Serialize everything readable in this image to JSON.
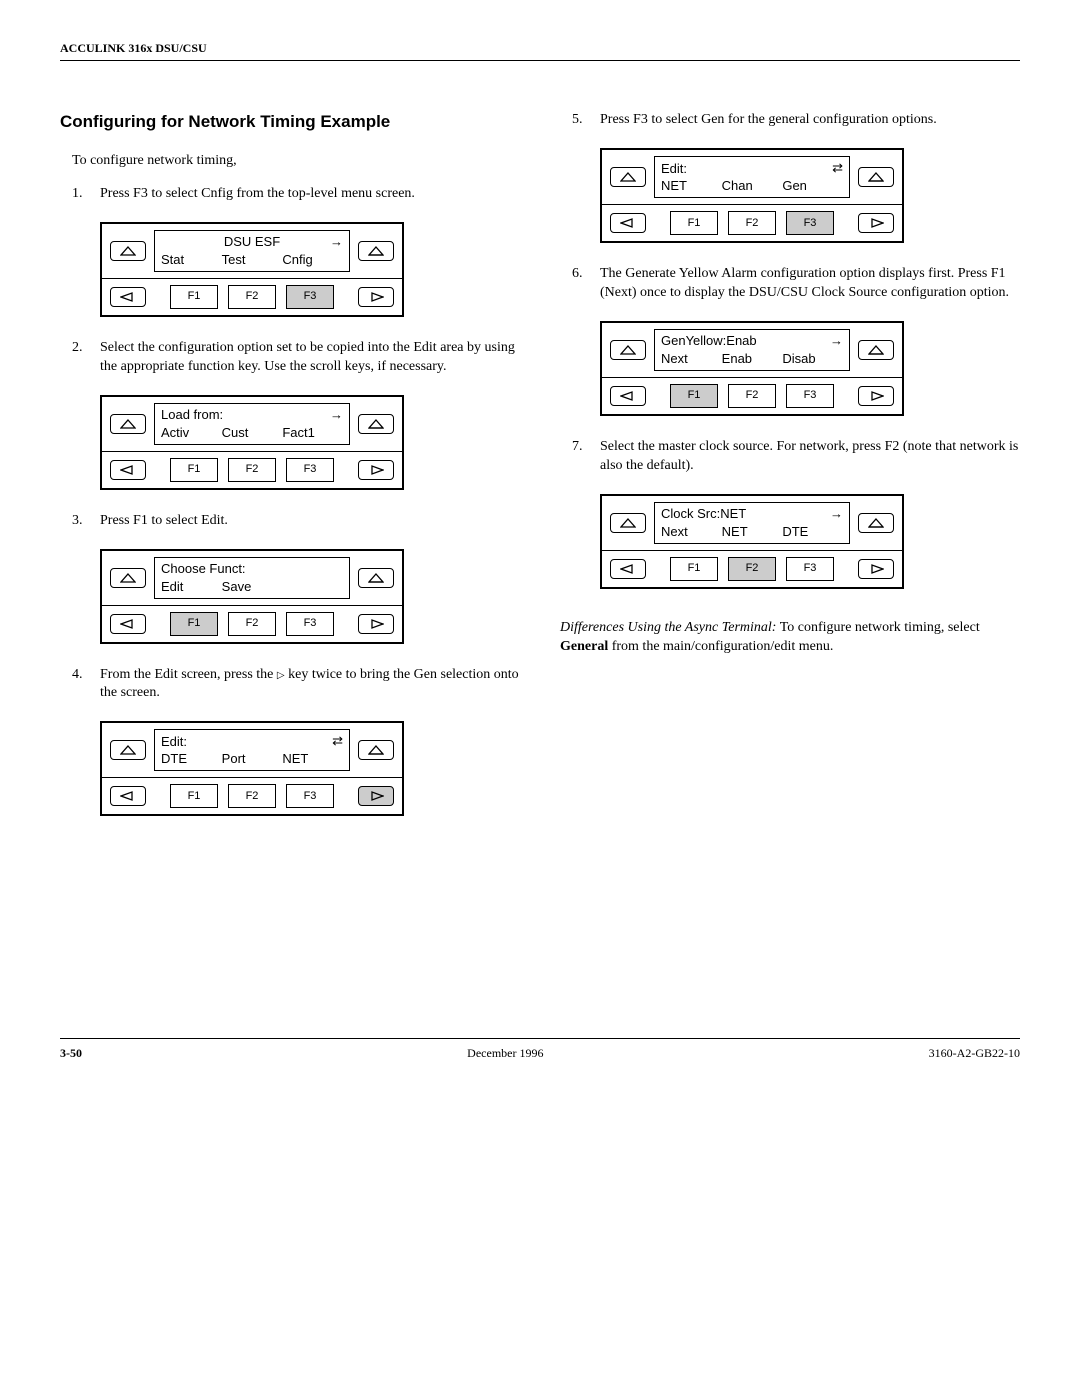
{
  "header": "ACCULINK 316x DSU/CSU",
  "section_title": "Configuring for Network Timing Example",
  "intro": "To configure network timing,",
  "left_steps": [
    {
      "num": "1.",
      "text": "Press F3 to select Cnfig from the top-level menu screen.",
      "lcd": {
        "l1": "DSU ESF",
        "l1_center": true,
        "l2": [
          "Stat",
          "Test",
          "Cnfig"
        ],
        "arrow": "→"
      },
      "keys": [
        {
          "t": "F1"
        },
        {
          "t": "F2"
        },
        {
          "t": "F3",
          "hi": true
        }
      ],
      "right_hi": false
    },
    {
      "num": "2.",
      "text": "Select the configuration option set to be copied into the Edit area by using the appropriate function key. Use the scroll keys, if necessary.",
      "lcd": {
        "l1": "Load from:",
        "l2": [
          "Activ",
          "Cust",
          "Fact1"
        ],
        "arrow": "→"
      },
      "keys": [
        {
          "t": "F1"
        },
        {
          "t": "F2"
        },
        {
          "t": "F3"
        }
      ],
      "right_hi": false
    },
    {
      "num": "3.",
      "text": "Press F1 to select Edit.",
      "lcd": {
        "l1": "Choose Funct:",
        "l2": [
          "Edit",
          "Save",
          ""
        ],
        "arrow": ""
      },
      "keys": [
        {
          "t": "F1",
          "hi": true
        },
        {
          "t": "F2"
        },
        {
          "t": "F3"
        }
      ],
      "right_hi": false
    },
    {
      "num": "4.",
      "text_pre": "From the Edit screen, press the ",
      "text_post": " key twice to bring the Gen selection onto the screen.",
      "lcd": {
        "l1": "Edit:",
        "l2": [
          "DTE",
          "Port",
          "NET"
        ],
        "arrow": "⇄"
      },
      "keys": [
        {
          "t": "F1"
        },
        {
          "t": "F2"
        },
        {
          "t": "F3"
        }
      ],
      "right_hi": true
    }
  ],
  "right_steps": [
    {
      "num": "5.",
      "text": "Press F3 to select Gen for the general configuration options.",
      "lcd": {
        "l1": "Edit:",
        "l2": [
          "NET",
          "Chan",
          "Gen"
        ],
        "arrow": "⇄"
      },
      "keys": [
        {
          "t": "F1"
        },
        {
          "t": "F2"
        },
        {
          "t": "F3",
          "hi": true
        }
      ],
      "right_hi": false
    },
    {
      "num": "6.",
      "text": "The Generate Yellow Alarm configuration option displays first. Press F1 (Next) once to display the DSU/CSU Clock Source configuration option.",
      "lcd": {
        "l1": "GenYellow:Enab",
        "l2": [
          "Next",
          "Enab",
          "Disab"
        ],
        "arrow": "→"
      },
      "keys": [
        {
          "t": "F1",
          "hi": true
        },
        {
          "t": "F2"
        },
        {
          "t": "F3"
        }
      ],
      "right_hi": false
    },
    {
      "num": "7.",
      "text": "Select the master clock source. For network, press F2 (note that network is also the default).",
      "lcd": {
        "l1": "Clock Src:NET",
        "l2": [
          "Next",
          "NET",
          "DTE"
        ],
        "arrow": "→"
      },
      "keys": [
        {
          "t": "F1"
        },
        {
          "t": "F2",
          "hi": true
        },
        {
          "t": "F3"
        }
      ],
      "right_hi": false
    }
  ],
  "note_em": "Differences Using the Async Terminal:",
  "note_rest": " To configure network timing, select ",
  "note_bold": "General",
  "note_tail": " from the main/configuration/edit menu.",
  "footer": {
    "left": "3-50",
    "center": "December 1996",
    "right": "3160-A2-GB22-10"
  }
}
